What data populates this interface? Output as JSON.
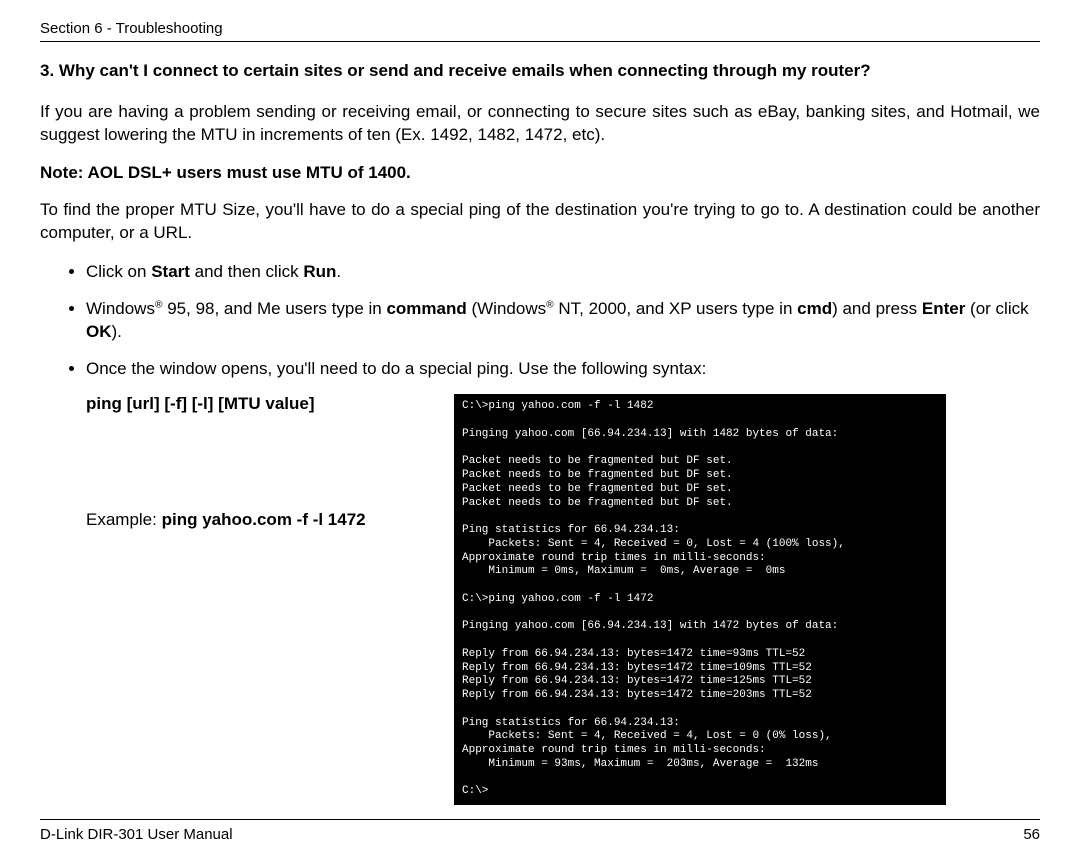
{
  "header": {
    "section": "Section 6 - Troubleshooting"
  },
  "q": {
    "num": "3.",
    "text": "Why can't I connect to certain sites or send and receive emails when connecting through my router?"
  },
  "p1": "If you are having a problem sending or receiving email, or connecting to secure sites such as eBay, banking sites, and Hotmail, we suggest lowering the MTU in increments of ten (Ex. 1492, 1482, 1472, etc).",
  "note": "Note: AOL DSL+ users must use MTU of 1400.",
  "p2": "To find the proper MTU Size, you'll have to do a special ping of the destination you're trying to go to. A destination could be another computer, or a URL.",
  "bul": {
    "b1a": "Click on ",
    "b1b": "Start",
    "b1c": " and then click ",
    "b1d": "Run",
    "b1e": ".",
    "b2a": "Windows",
    "b2reg": "®",
    "b2b": " 95, 98, and Me users type in ",
    "b2c": "command",
    "b2d": " (Windows",
    "b2e": " NT, 2000, and XP users type in ",
    "b2f": "cmd",
    "b2g": ") and press ",
    "b2h": "Enter",
    "b2i": " (or click ",
    "b2j": "OK",
    "b2k": ").",
    "b3": "Once the window opens, you'll need to do a special ping. Use the following syntax:"
  },
  "syntax": {
    "cmd": "ping [url] [-f] [-l] [MTU value]",
    "ex_pre": "Example: ",
    "ex_cmd": "ping yahoo.com -f -l 1472"
  },
  "term": {
    "l01": "C:\\>ping yahoo.com -f -l 1482",
    "l02": "",
    "l03": "Pinging yahoo.com [66.94.234.13] with 1482 bytes of data:",
    "l04": "",
    "l05": "Packet needs to be fragmented but DF set.",
    "l06": "Packet needs to be fragmented but DF set.",
    "l07": "Packet needs to be fragmented but DF set.",
    "l08": "Packet needs to be fragmented but DF set.",
    "l09": "",
    "l10": "Ping statistics for 66.94.234.13:",
    "l11": "    Packets: Sent = 4, Received = 0, Lost = 4 (100% loss),",
    "l12": "Approximate round trip times in milli-seconds:",
    "l13": "    Minimum = 0ms, Maximum =  0ms, Average =  0ms",
    "l14": "",
    "l15": "C:\\>ping yahoo.com -f -l 1472",
    "l16": "",
    "l17": "Pinging yahoo.com [66.94.234.13] with 1472 bytes of data:",
    "l18": "",
    "l19": "Reply from 66.94.234.13: bytes=1472 time=93ms TTL=52",
    "l20": "Reply from 66.94.234.13: bytes=1472 time=109ms TTL=52",
    "l21": "Reply from 66.94.234.13: bytes=1472 time=125ms TTL=52",
    "l22": "Reply from 66.94.234.13: bytes=1472 time=203ms TTL=52",
    "l23": "",
    "l24": "Ping statistics for 66.94.234.13:",
    "l25": "    Packets: Sent = 4, Received = 4, Lost = 0 (0% loss),",
    "l26": "Approximate round trip times in milli-seconds:",
    "l27": "    Minimum = 93ms, Maximum =  203ms, Average =  132ms",
    "l28": "",
    "l29": "C:\\>"
  },
  "footer": {
    "left": "D-Link DIR-301 User Manual",
    "right": "56"
  }
}
